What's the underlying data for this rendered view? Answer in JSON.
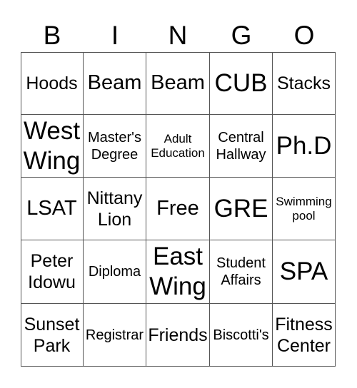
{
  "header": {
    "letters": [
      "B",
      "I",
      "N",
      "G",
      "O"
    ]
  },
  "card": {
    "rows": [
      [
        {
          "text": "Hoods",
          "size": "l"
        },
        {
          "text": "Beam",
          "size": "xl"
        },
        {
          "text": "Beam",
          "size": "xl"
        },
        {
          "text": "CUB",
          "size": "xxl"
        },
        {
          "text": "Stacks",
          "size": "l"
        }
      ],
      [
        {
          "text": "West\nWing",
          "size": "xxl"
        },
        {
          "text": "Master's\nDegree",
          "size": "m"
        },
        {
          "text": "Adult\nEducation",
          "size": "s"
        },
        {
          "text": "Central\nHallway",
          "size": "m"
        },
        {
          "text": "Ph.D",
          "size": "xxl"
        }
      ],
      [
        {
          "text": "LSAT",
          "size": "xl"
        },
        {
          "text": "Nittany\nLion",
          "size": "l"
        },
        {
          "text": "Free",
          "size": "xl"
        },
        {
          "text": "GRE",
          "size": "xxl"
        },
        {
          "text": "Swimming\npool",
          "size": "s"
        }
      ],
      [
        {
          "text": "Peter\nIdowu",
          "size": "l"
        },
        {
          "text": "Diploma",
          "size": "m"
        },
        {
          "text": "East\nWing",
          "size": "xxl"
        },
        {
          "text": "Student\nAffairs",
          "size": "m"
        },
        {
          "text": "SPA",
          "size": "xxl"
        }
      ],
      [
        {
          "text": "Sunset\nPark",
          "size": "l"
        },
        {
          "text": "Registrar",
          "size": "m"
        },
        {
          "text": "Friends",
          "size": "l"
        },
        {
          "text": "Biscotti's",
          "size": "m"
        },
        {
          "text": "Fitness\nCenter",
          "size": "l"
        }
      ]
    ]
  }
}
